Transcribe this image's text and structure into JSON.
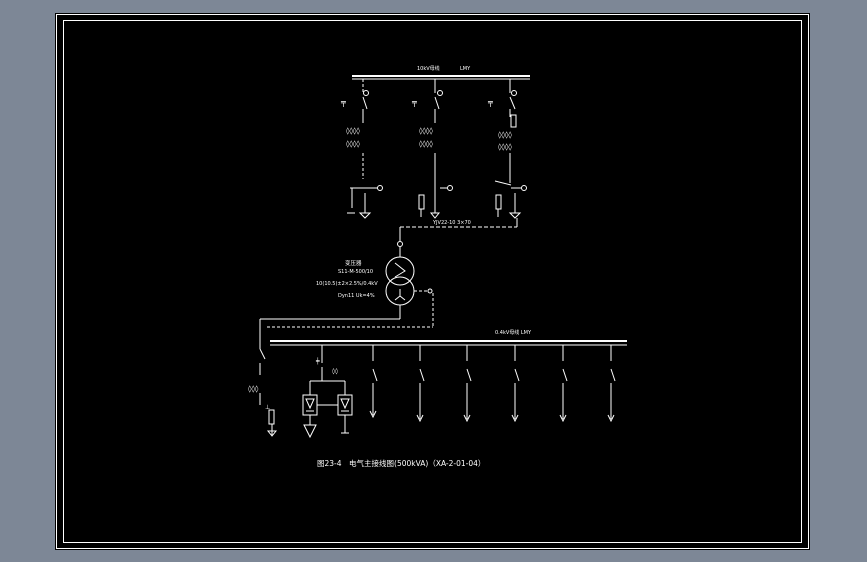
{
  "diagram": {
    "hv_bus_label": "10kV母线",
    "hv_bus_spec": "LMY",
    "hv_cable_label": "YJV22-10 3×70",
    "transformer_name": "变压器",
    "transformer_model": "S11-M-500/10",
    "transformer_ratio": "10(10.5)±2×2.5%/0.4kV",
    "transformer_group": "Dyn11 Uk=4%",
    "lv_bus_label": "0.4kV母线 LMY",
    "caption": "图23-4　电气主接线图(500kVA)（XA-2-01-04）"
  },
  "colors": {
    "background": "#7d8796",
    "sheet": "#000000",
    "line": "#ffffff"
  }
}
